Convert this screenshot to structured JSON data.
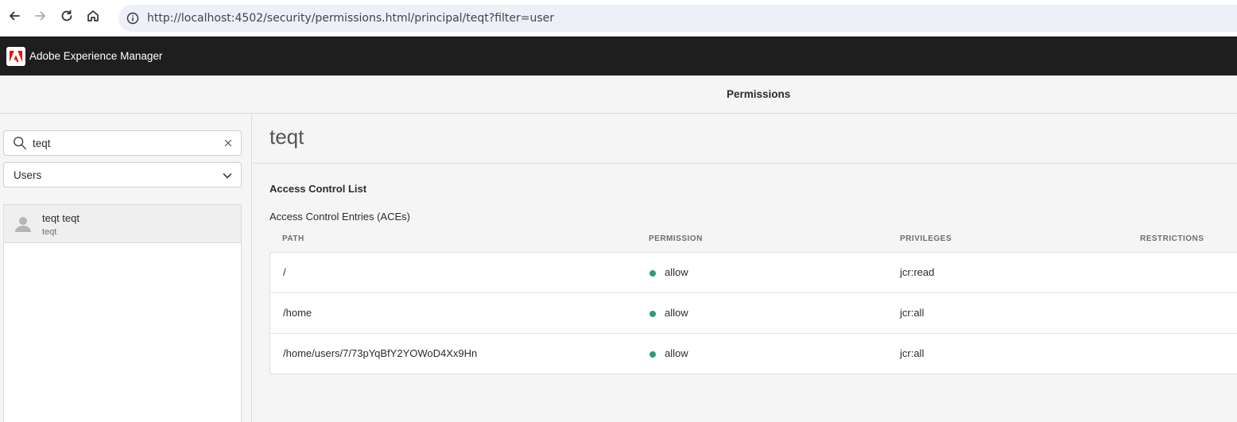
{
  "browser": {
    "url": "http://localhost:4502/security/permissions.html/principal/teqt?filter=user"
  },
  "shell": {
    "product_name": "Adobe Experience Manager",
    "logo_color": "#eb1000"
  },
  "header": {
    "title": "Permissions"
  },
  "sidebar": {
    "search_value": "teqt",
    "filter_selected": "Users",
    "users": [
      {
        "name": "teqt teqt",
        "id": "teqt"
      }
    ]
  },
  "main": {
    "principal": "teqt",
    "acl_heading": "Access Control List",
    "ace_heading": "Access Control Entries (ACEs)",
    "columns": {
      "path": "PATH",
      "permission": "PERMISSION",
      "privileges": "PRIVILEGES",
      "restrictions": "RESTRICTIONS"
    },
    "allow_color": "#2d9d78",
    "rows": [
      {
        "path": "/",
        "permission": "allow",
        "privileges": "jcr:read",
        "restrictions": ""
      },
      {
        "path": "/home",
        "permission": "allow",
        "privileges": "jcr:all",
        "restrictions": ""
      },
      {
        "path": "/home/users/7/73pYqBfY2YOWoD4Xx9Hn",
        "permission": "allow",
        "privileges": "jcr:all",
        "restrictions": ""
      }
    ]
  }
}
